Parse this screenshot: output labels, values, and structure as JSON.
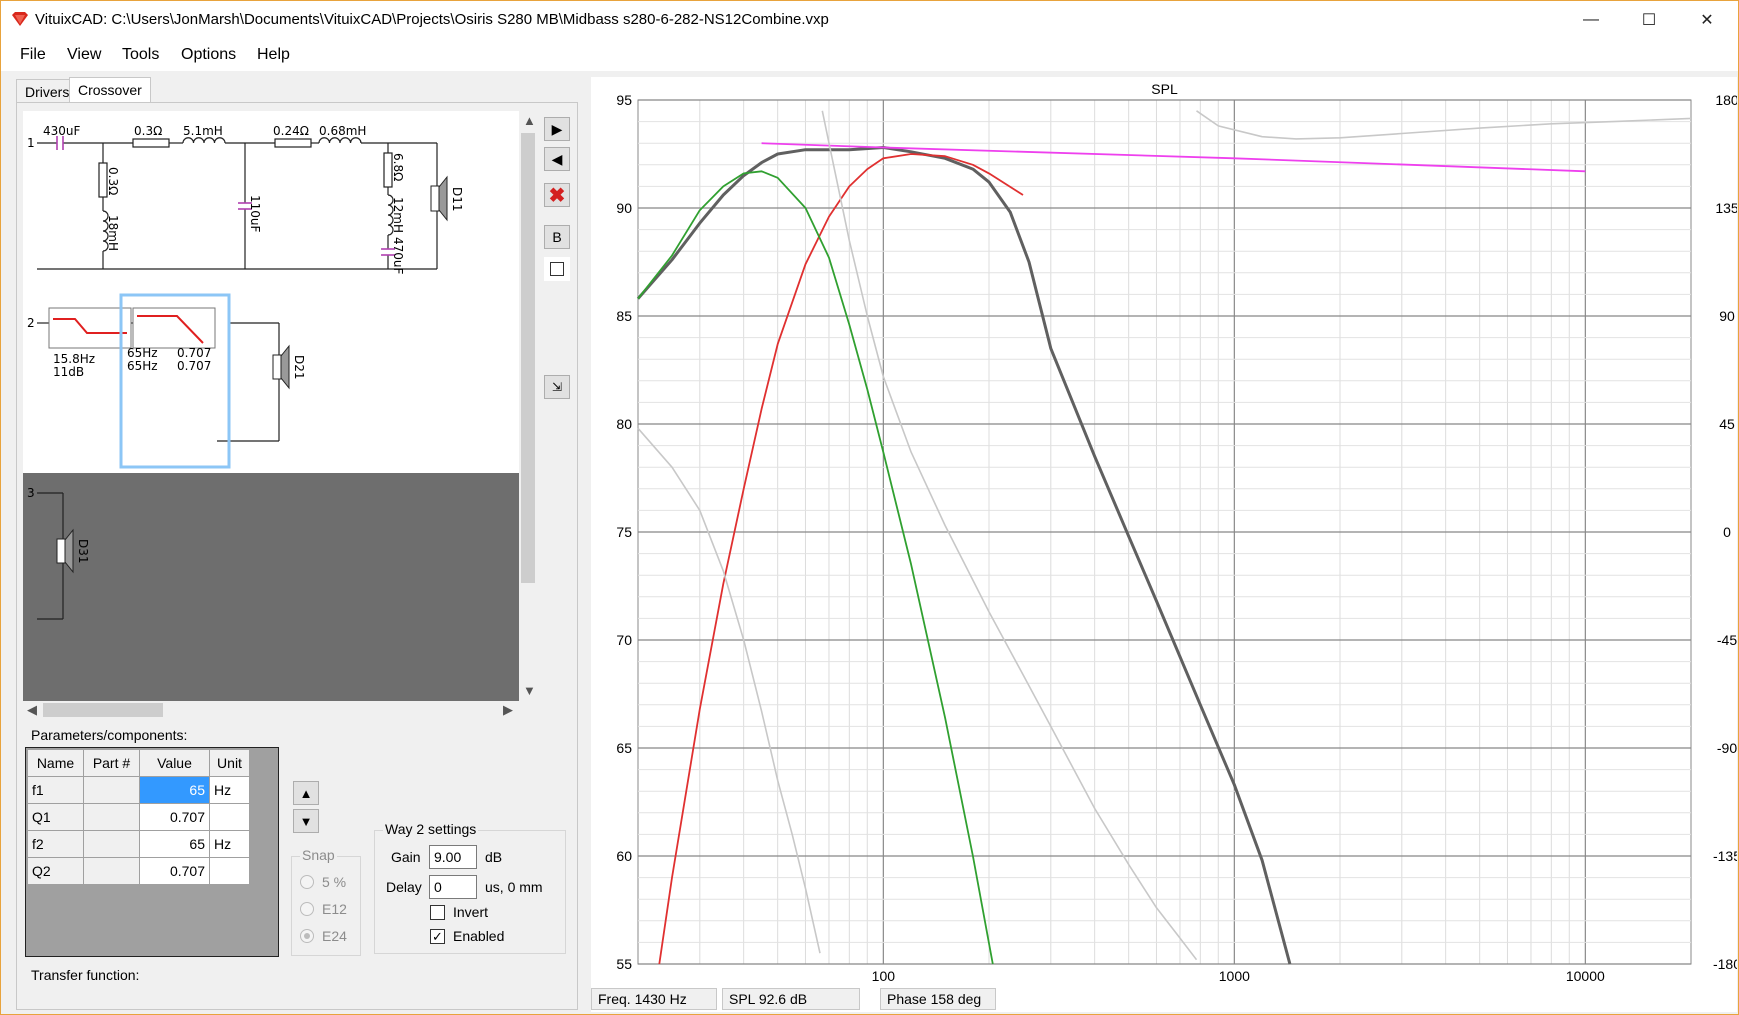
{
  "window": {
    "title": "VituixCAD: C:\\Users\\JonMarsh\\Documents\\VituixCAD\\Projects\\Osiris S280 MB\\Midbass s280-6-282-NS12Combine.vxp",
    "minimize_icon": "minimize-icon",
    "maximize_icon": "maximize-icon",
    "close_icon": "close-icon"
  },
  "menu": {
    "file": "File",
    "view": "View",
    "tools": "Tools",
    "options": "Options",
    "help": "Help"
  },
  "tabs": [
    {
      "label": "Drivers"
    },
    {
      "label": "Crossover"
    }
  ],
  "schematic": {
    "way1": {
      "number": "1",
      "c1": "430uF",
      "r1": "0.3Ω",
      "l1": "5.1mH",
      "r2": "0.24Ω",
      "l2": "0.68mH",
      "shunt_r": "0.3Ω",
      "shunt_l": "18mH",
      "shunt_c": "110uF",
      "notch_r": "6.8Ω",
      "notch_l": "12mH",
      "notch_c": "470uF",
      "driver": "D11"
    },
    "way2": {
      "number": "2",
      "block1_line1": "15.8Hz",
      "block1_line2": "11dB",
      "block2_f1": "65Hz",
      "block2_q1": "0.707",
      "block2_f2": "65Hz",
      "block2_q2": "0.707",
      "driver": "D21"
    },
    "way3": {
      "number": "3",
      "driver": "D31"
    }
  },
  "side_buttons": {
    "b_label": "B"
  },
  "parameters": {
    "label": "Parameters/components:",
    "columns": [
      "Name",
      "Part #",
      "Value",
      "Unit"
    ],
    "rows": [
      {
        "name": "f1",
        "part": "",
        "value": "65",
        "unit": "Hz"
      },
      {
        "name": "Q1",
        "part": "",
        "value": "0.707",
        "unit": ""
      },
      {
        "name": "f2",
        "part": "",
        "value": "65",
        "unit": "Hz"
      },
      {
        "name": "Q2",
        "part": "",
        "value": "0.707",
        "unit": ""
      }
    ]
  },
  "snap": {
    "label": "Snap",
    "options": [
      "5 %",
      "E12",
      "E24"
    ],
    "selected": "E24"
  },
  "way_settings": {
    "title": "Way 2 settings",
    "gain_label": "Gain",
    "gain_value": "9.00",
    "gain_unit": "dB",
    "delay_label": "Delay",
    "delay_value": "0",
    "delay_unit": "us, 0 mm",
    "invert_label": "Invert",
    "invert_checked": false,
    "enabled_label": "Enabled",
    "enabled_checked": true
  },
  "transfer_label": "Transfer function:",
  "status": {
    "freq": "Freq.  1430 Hz",
    "spl": "SPL  92.6 dB",
    "phase": "Phase     158 deg"
  },
  "chart_data": {
    "type": "line",
    "title": "SPL",
    "x_scale": "log",
    "xlim": [
      20,
      20000
    ],
    "ylim": [
      55,
      95
    ],
    "y2lim": [
      -180,
      180
    ],
    "x_ticks": [
      100,
      1000,
      10000
    ],
    "x_tick_labels": [
      "100",
      "1000",
      "10000"
    ],
    "y_ticks": [
      95,
      90,
      85,
      80,
      75,
      70,
      65,
      60,
      55
    ],
    "y2_ticks": [
      180,
      135,
      90,
      45,
      0,
      -45,
      -90,
      -135,
      -180
    ],
    "grid": true,
    "series": [
      {
        "color": "#606060",
        "x": [
          20,
          25,
          30,
          35,
          40,
          45,
          50,
          60,
          70,
          80,
          100,
          120,
          150,
          180,
          200,
          230,
          260,
          300,
          400,
          500,
          600,
          800,
          1000,
          1200,
          1440
        ],
        "y": [
          85.8,
          87.6,
          89.3,
          90.6,
          91.5,
          92.1,
          92.5,
          92.7,
          92.7,
          92.7,
          92.8,
          92.6,
          92.3,
          91.8,
          91.2,
          89.8,
          87.5,
          83.5,
          78.5,
          74.8,
          71.8,
          67.0,
          63.3,
          59.8,
          55
        ]
      },
      {
        "color": "#e03030",
        "x": [
          23,
          25,
          30,
          35,
          40,
          45,
          50,
          60,
          70,
          80,
          90,
          100,
          120,
          150,
          180,
          200,
          250
        ],
        "y": [
          55,
          59.0,
          66.8,
          72.6,
          77.0,
          80.7,
          83.7,
          87.4,
          89.6,
          91.0,
          91.8,
          92.3,
          92.5,
          92.4,
          92.0,
          91.6,
          90.6
        ]
      },
      {
        "color": "#30a030",
        "x": [
          20,
          25,
          30,
          35,
          40,
          45,
          50,
          60,
          70,
          80,
          90,
          100,
          120,
          150,
          180,
          205
        ],
        "y": [
          85.8,
          87.8,
          89.9,
          91.0,
          91.6,
          91.7,
          91.4,
          90.0,
          87.7,
          84.6,
          81.6,
          78.7,
          73.5,
          66.4,
          60.0,
          55
        ]
      },
      {
        "color": "#ee40ee",
        "x": [
          45,
          100,
          1000,
          10000
        ],
        "y": [
          93.0,
          92.8,
          92.3,
          91.7
        ]
      },
      {
        "color": "#c8c8c8",
        "x": [
          20,
          25,
          30,
          35,
          40,
          45,
          50,
          55,
          60,
          66
        ],
        "y": [
          79.8,
          78.0,
          76.0,
          73.2,
          70.0,
          66.7,
          63.5,
          61.0,
          58.5,
          55.5
        ]
      },
      {
        "color": "#c8c8c8",
        "x": [
          67,
          70,
          80,
          90,
          100,
          120,
          150,
          200,
          250,
          300,
          400,
          500,
          600,
          700,
          780
        ],
        "y": [
          94.5,
          93.0,
          88.5,
          85.0,
          82.2,
          78.7,
          75.3,
          71.3,
          68.4,
          66.0,
          62.2,
          59.6,
          57.6,
          56.2,
          55.2
        ]
      },
      {
        "color": "#c8c8c8",
        "x": [
          780,
          900,
          1200,
          1500,
          2000,
          3000,
          5000,
          8000,
          12000,
          20000
        ],
        "y": [
          94.5,
          93.8,
          93.3,
          93.2,
          93.25,
          93.45,
          93.7,
          93.9,
          94.0,
          94.15
        ]
      }
    ]
  }
}
